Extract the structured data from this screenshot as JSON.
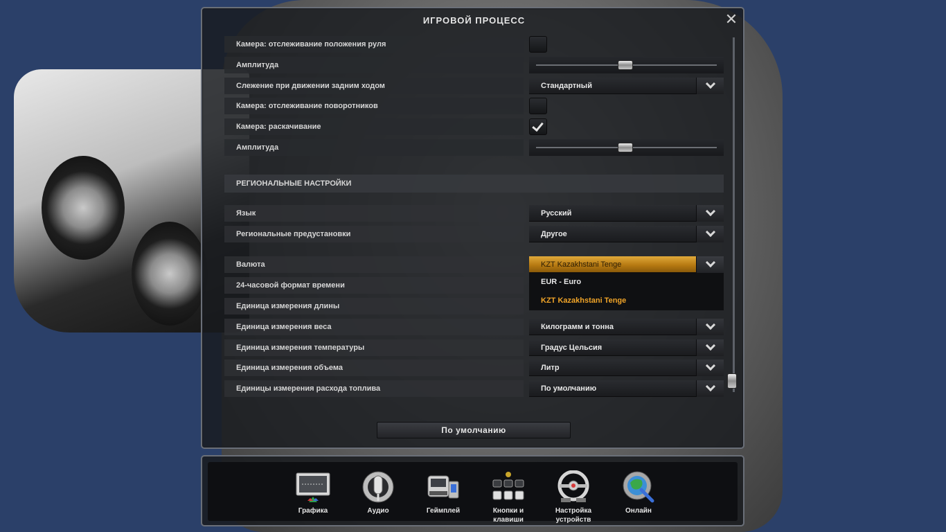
{
  "dialog": {
    "title": "ИГРОВОЙ ПРОЦЕСС",
    "close_symbol": "✕"
  },
  "settings": {
    "rows": [
      {
        "label": "Камера: отслеживание положения руля",
        "control": "checkbox",
        "checked": false
      },
      {
        "label": "Амплитуда",
        "control": "slider",
        "level_percent": 48
      },
      {
        "label": "Слежение при движении задним ходом",
        "control": "dropdown",
        "value": "Стандартный"
      },
      {
        "label": "Камера: отслеживание поворотников",
        "control": "checkbox",
        "checked": false
      },
      {
        "label": "Камера: раскачивание",
        "control": "checkbox",
        "checked": true
      },
      {
        "label": "Амплитуда",
        "control": "slider",
        "level_percent": 48
      }
    ],
    "regional_header": "РЕГИОНАЛЬНЫЕ НАСТРОЙКИ",
    "regional": [
      {
        "label": "Язык",
        "value": "Русский"
      },
      {
        "label": "Региональные предустановки",
        "value": "Другое"
      },
      {
        "label": "Валюта",
        "value": "KZT  Kazakhstani Tenge"
      },
      {
        "label": "24-часовой формат времени",
        "value": ""
      },
      {
        "label": "Единица измерения длины",
        "value": ""
      },
      {
        "label": "Единица измерения веса",
        "value": "Килограмм и тонна"
      },
      {
        "label": "Единица измерения температуры",
        "value": "Градус Цельсия"
      },
      {
        "label": "Единица измерения объема",
        "value": "Литр"
      },
      {
        "label": "Единицы измерения расхода топлива",
        "value": "По умолчанию"
      }
    ],
    "currency_options": [
      "EUR - Euro",
      "KZT  Kazakhstani Tenge"
    ],
    "default_button": "По умолчанию"
  },
  "nav": {
    "items": [
      {
        "label": "Графика",
        "icon": "monitor-icon"
      },
      {
        "label": "Аудио",
        "icon": "microphone-icon"
      },
      {
        "label": "Геймплей",
        "icon": "truck-icon"
      },
      {
        "label": "Кнопки и клавиши",
        "label_line1": "Кнопки и",
        "label_line2": "клавиши",
        "icon": "keyboard-icon"
      },
      {
        "label": "Настройка устройств",
        "label_line1": "Настройка",
        "label_line2": "устройств",
        "icon": "steering-wheel-icon"
      },
      {
        "label": "Онлайн",
        "icon": "globe-icon"
      }
    ]
  },
  "colors": {
    "background": "#2b4069",
    "accent": "#f0a428",
    "active_dropdown": "#d19a30"
  }
}
